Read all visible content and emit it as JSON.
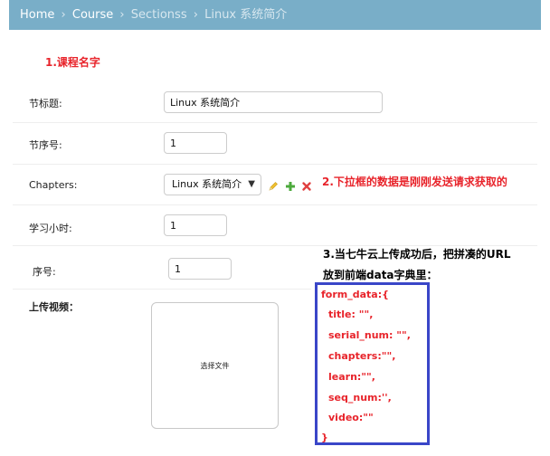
{
  "breadcrumb": {
    "home": "Home",
    "course": "Course",
    "sections": "Sectionss",
    "current": "Linux 系统简介",
    "separator": "›"
  },
  "annotations": {
    "course_name": "1.课程名字",
    "dropdown_note": "2.下拉框的数据是刚刚发送请求获取的",
    "upload_note_line1": "3.当七牛云上传成功后，把拼凑的URL",
    "upload_note_line2": "放到前端data字典里："
  },
  "form": {
    "title_label": "节标题:",
    "title_value": "Linux 系统简介",
    "serial_label": "节序号:",
    "serial_value": "1",
    "chapters_label": "Chapters:",
    "chapters_selected": "Linux 系统简介",
    "learn_label": "学习小时:",
    "learn_value": "1",
    "seq_label": "序号:",
    "seq_value": "1",
    "video_label": "上传视频：",
    "file_button": "选择文件"
  },
  "code_snippet": {
    "lines": [
      "form_data:{",
      "title: \"\",",
      "serial_num: \"\",",
      "chapters:\"\",",
      "learn:\"\",",
      "seq_num:'',",
      "video:\"\"",
      "}"
    ]
  },
  "colors": {
    "breadcrumb_bg": "#79aec8",
    "annotation_red": "#e8242b",
    "code_border": "#3a46c8",
    "edit_icon": "#f0c030",
    "add_icon": "#4caa3c",
    "delete_icon": "#e04040"
  },
  "icons": [
    "edit-pencil-icon",
    "add-plus-icon",
    "delete-x-icon",
    "chevron-down-icon"
  ]
}
